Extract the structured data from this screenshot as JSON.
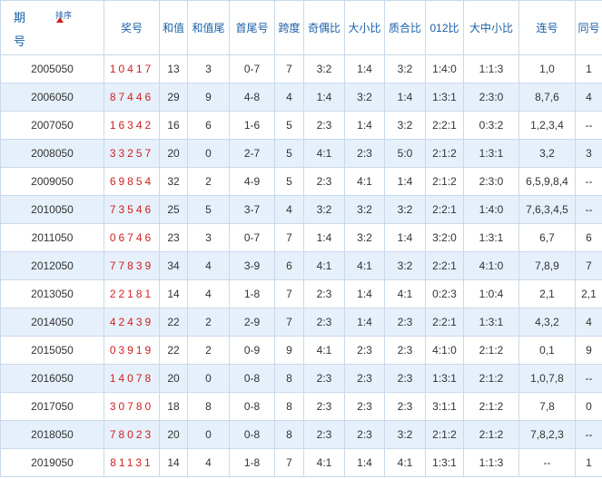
{
  "headers": {
    "period_top": "期",
    "period_bottom": "号",
    "sort_label": "排序",
    "columns": [
      "奖号",
      "和值",
      "和值尾",
      "首尾号",
      "跨度",
      "奇偶比",
      "大小比",
      "质合比",
      "012比",
      "大中小比",
      "连号",
      "同号"
    ]
  },
  "rows": [
    {
      "period": "2005050",
      "number": "10417",
      "sum": "13",
      "tail": "3",
      "first_last": "0-7",
      "span": "7",
      "odd_even": "3:2",
      "big_small": "1:4",
      "prime": "3:2",
      "r012": "1:4:0",
      "bms": "1:1:3",
      "consec": "1,0",
      "same": "1"
    },
    {
      "period": "2006050",
      "number": "87446",
      "sum": "29",
      "tail": "9",
      "first_last": "4-8",
      "span": "4",
      "odd_even": "1:4",
      "big_small": "3:2",
      "prime": "1:4",
      "r012": "1:3:1",
      "bms": "2:3:0",
      "consec": "8,7,6",
      "same": "4"
    },
    {
      "period": "2007050",
      "number": "16342",
      "sum": "16",
      "tail": "6",
      "first_last": "1-6",
      "span": "5",
      "odd_even": "2:3",
      "big_small": "1:4",
      "prime": "3:2",
      "r012": "2:2:1",
      "bms": "0:3:2",
      "consec": "1,2,3,4",
      "same": "--"
    },
    {
      "period": "2008050",
      "number": "33257",
      "sum": "20",
      "tail": "0",
      "first_last": "2-7",
      "span": "5",
      "odd_even": "4:1",
      "big_small": "2:3",
      "prime": "5:0",
      "r012": "2:1:2",
      "bms": "1:3:1",
      "consec": "3,2",
      "same": "3"
    },
    {
      "period": "2009050",
      "number": "69854",
      "sum": "32",
      "tail": "2",
      "first_last": "4-9",
      "span": "5",
      "odd_even": "2:3",
      "big_small": "4:1",
      "prime": "1:4",
      "r012": "2:1:2",
      "bms": "2:3:0",
      "consec": "6,5,9,8,4",
      "same": "--"
    },
    {
      "period": "2010050",
      "number": "73546",
      "sum": "25",
      "tail": "5",
      "first_last": "3-7",
      "span": "4",
      "odd_even": "3:2",
      "big_small": "3:2",
      "prime": "3:2",
      "r012": "2:2:1",
      "bms": "1:4:0",
      "consec": "7,6,3,4,5",
      "same": "--"
    },
    {
      "period": "2011050",
      "number": "06746",
      "sum": "23",
      "tail": "3",
      "first_last": "0-7",
      "span": "7",
      "odd_even": "1:4",
      "big_small": "3:2",
      "prime": "1:4",
      "r012": "3:2:0",
      "bms": "1:3:1",
      "consec": "6,7",
      "same": "6"
    },
    {
      "period": "2012050",
      "number": "77839",
      "sum": "34",
      "tail": "4",
      "first_last": "3-9",
      "span": "6",
      "odd_even": "4:1",
      "big_small": "4:1",
      "prime": "3:2",
      "r012": "2:2:1",
      "bms": "4:1:0",
      "consec": "7,8,9",
      "same": "7"
    },
    {
      "period": "2013050",
      "number": "22181",
      "sum": "14",
      "tail": "4",
      "first_last": "1-8",
      "span": "7",
      "odd_even": "2:3",
      "big_small": "1:4",
      "prime": "4:1",
      "r012": "0:2:3",
      "bms": "1:0:4",
      "consec": "2,1",
      "same": "2,1"
    },
    {
      "period": "2014050",
      "number": "42439",
      "sum": "22",
      "tail": "2",
      "first_last": "2-9",
      "span": "7",
      "odd_even": "2:3",
      "big_small": "1:4",
      "prime": "2:3",
      "r012": "2:2:1",
      "bms": "1:3:1",
      "consec": "4,3,2",
      "same": "4"
    },
    {
      "period": "2015050",
      "number": "03919",
      "sum": "22",
      "tail": "2",
      "first_last": "0-9",
      "span": "9",
      "odd_even": "4:1",
      "big_small": "2:3",
      "prime": "2:3",
      "r012": "4:1:0",
      "bms": "2:1:2",
      "consec": "0,1",
      "same": "9"
    },
    {
      "period": "2016050",
      "number": "14078",
      "sum": "20",
      "tail": "0",
      "first_last": "0-8",
      "span": "8",
      "odd_even": "2:3",
      "big_small": "2:3",
      "prime": "2:3",
      "r012": "1:3:1",
      "bms": "2:1:2",
      "consec": "1,0,7,8",
      "same": "--"
    },
    {
      "period": "2017050",
      "number": "30780",
      "sum": "18",
      "tail": "8",
      "first_last": "0-8",
      "span": "8",
      "odd_even": "2:3",
      "big_small": "2:3",
      "prime": "2:3",
      "r012": "3:1:1",
      "bms": "2:1:2",
      "consec": "7,8",
      "same": "0"
    },
    {
      "period": "2018050",
      "number": "78023",
      "sum": "20",
      "tail": "0",
      "first_last": "0-8",
      "span": "8",
      "odd_even": "2:3",
      "big_small": "2:3",
      "prime": "3:2",
      "r012": "2:1:2",
      "bms": "2:1:2",
      "consec": "7,8,2,3",
      "same": "--"
    },
    {
      "period": "2019050",
      "number": "81131",
      "sum": "14",
      "tail": "4",
      "first_last": "1-8",
      "span": "7",
      "odd_even": "4:1",
      "big_small": "1:4",
      "prime": "4:1",
      "r012": "1:3:1",
      "bms": "1:1:3",
      "consec": "--",
      "same": "1"
    }
  ]
}
